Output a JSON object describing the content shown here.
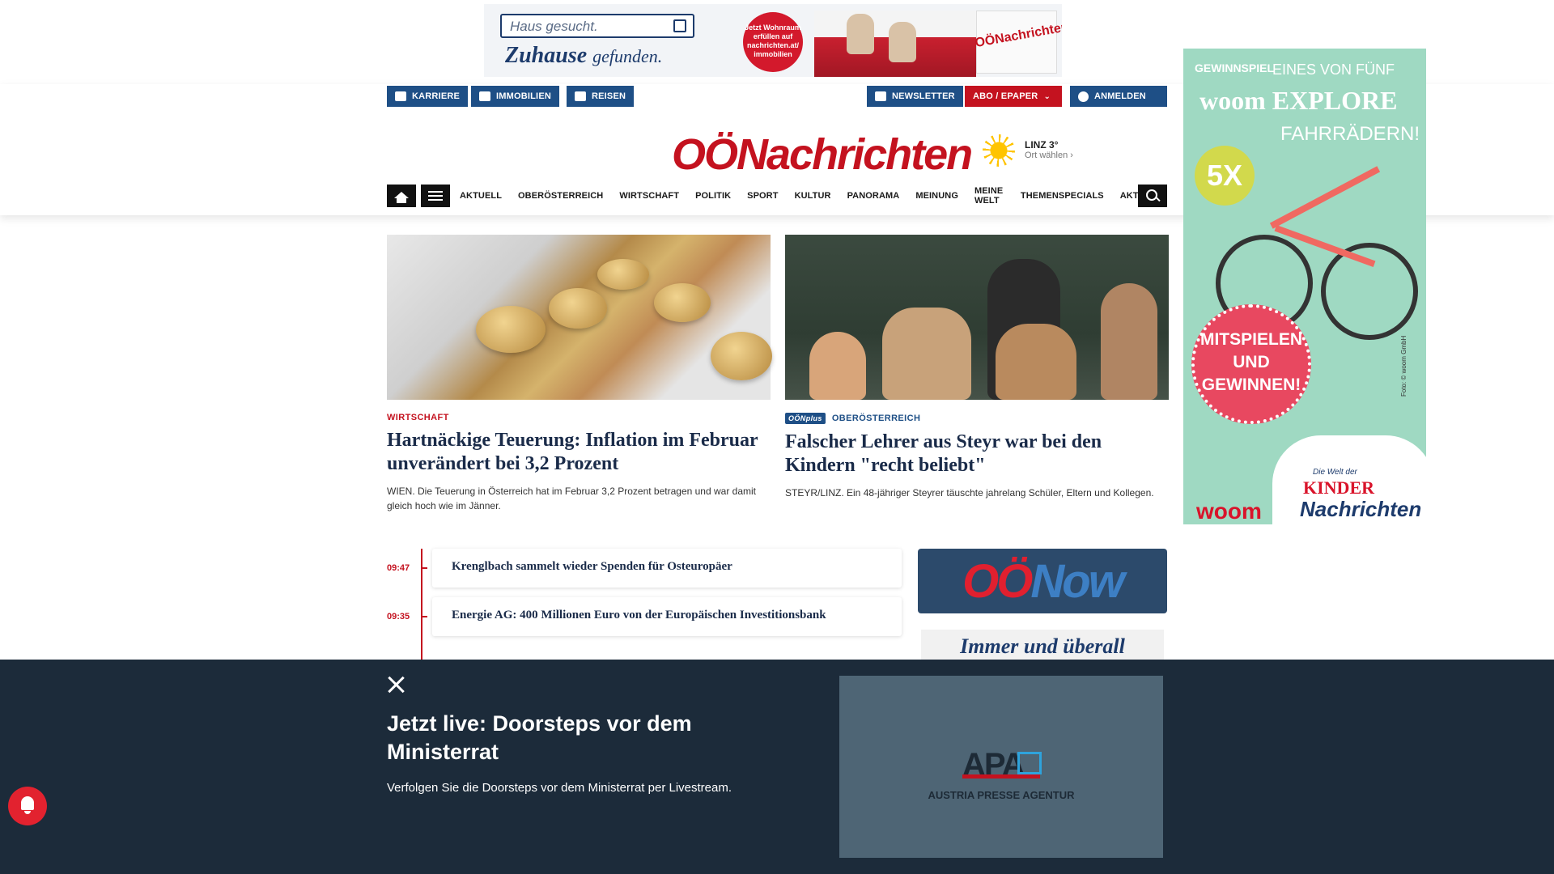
{
  "top_ad": {
    "search_text": "Haus gesucht.",
    "slogan_main": "Zuhause",
    "slogan_sub": "gefunden.",
    "burst_text": "Jetzt Wohnraum erfüllen auf nachrichten.at/ immobilien",
    "paper_logo": "OÖNachrichten"
  },
  "header": {
    "left_buttons": [
      "KARRIERE",
      "IMMOBILIEN",
      "REISEN"
    ],
    "newsletter": "NEWSLETTER",
    "abo": "ABO / EPAPER",
    "login": "ANMELDEN",
    "logo": "OÖNachrichten",
    "weather_city": "LINZ 3°",
    "weather_choose": "Ort wählen"
  },
  "nav": {
    "items": [
      "AKTUELL",
      "OBERÖSTERREICH",
      "WIRTSCHAFT",
      "POLITIK",
      "SPORT",
      "KULTUR",
      "PANORAMA",
      "MEINUNG",
      "MEINE WELT",
      "THEMENSPECIALS",
      "AKTIONEN"
    ]
  },
  "articles": [
    {
      "kicker": "WIRTSCHAFT",
      "title": "Hartnäckige Teuerung: Inflation im Februar unverändert bei 3,2 Prozent",
      "teaser": "WIEN. Die Teuerung in Österreich hat im Februar 3,2 Prozent betragen und war damit gleich hoch wie im Jänner."
    },
    {
      "badge": "OÖNplus",
      "kicker": "OBERÖSTERREICH",
      "title": "Falscher Lehrer aus Steyr war bei den Kindern \"recht beliebt\"",
      "teaser": "STEYR/LINZ. Ein 48-jähriger Steyrer täuschte jahrelang Schüler, Eltern und Kollegen."
    }
  ],
  "ticker": [
    {
      "time": "09:47",
      "title": "Krenglbach sammelt wieder Spenden für Osteuropäer"
    },
    {
      "time": "09:35",
      "title": "Energie AG: 400 Millionen Euro von der Europäischen Investitionsbank"
    }
  ],
  "oonow": {
    "oo": "OÖ",
    "now": "Now"
  },
  "immer": "Immer und überall",
  "side_ad": {
    "label": "GEWINNSPIEL",
    "line1": "EINES VON FÜNF",
    "line2": "woom EXPLORE",
    "line3": "FAHRRÄDERN!",
    "count": "5X",
    "bubble": "MITSPIELEN UND GEWINNEN!",
    "brand": "woom",
    "kinder_small": "Die Welt der",
    "kinder": "KINDER",
    "nachrichten": "Nachrichten",
    "credit": "Foto: © woom GmbH"
  },
  "overlay": {
    "title": "Jetzt live: Doorsteps vor dem Ministerrat",
    "description": "Verfolgen Sie die Doorsteps vor dem Ministerrat per Livestream.",
    "video_logo": "APA",
    "video_caption": "AUSTRIA PRESSE AGENTUR"
  },
  "colors": {
    "brand_red": "#c4121f",
    "brand_blue": "#1e4f86",
    "overlay_bg": "#1c2b3a",
    "headline": "#1a2b49"
  },
  "icons": [
    "briefcase-icon",
    "bank-icon",
    "plane-icon",
    "mail-icon",
    "chevron-down-icon",
    "user-icon",
    "sun-icon",
    "home-icon",
    "menu-icon",
    "search-icon",
    "close-icon",
    "bell-icon"
  ]
}
